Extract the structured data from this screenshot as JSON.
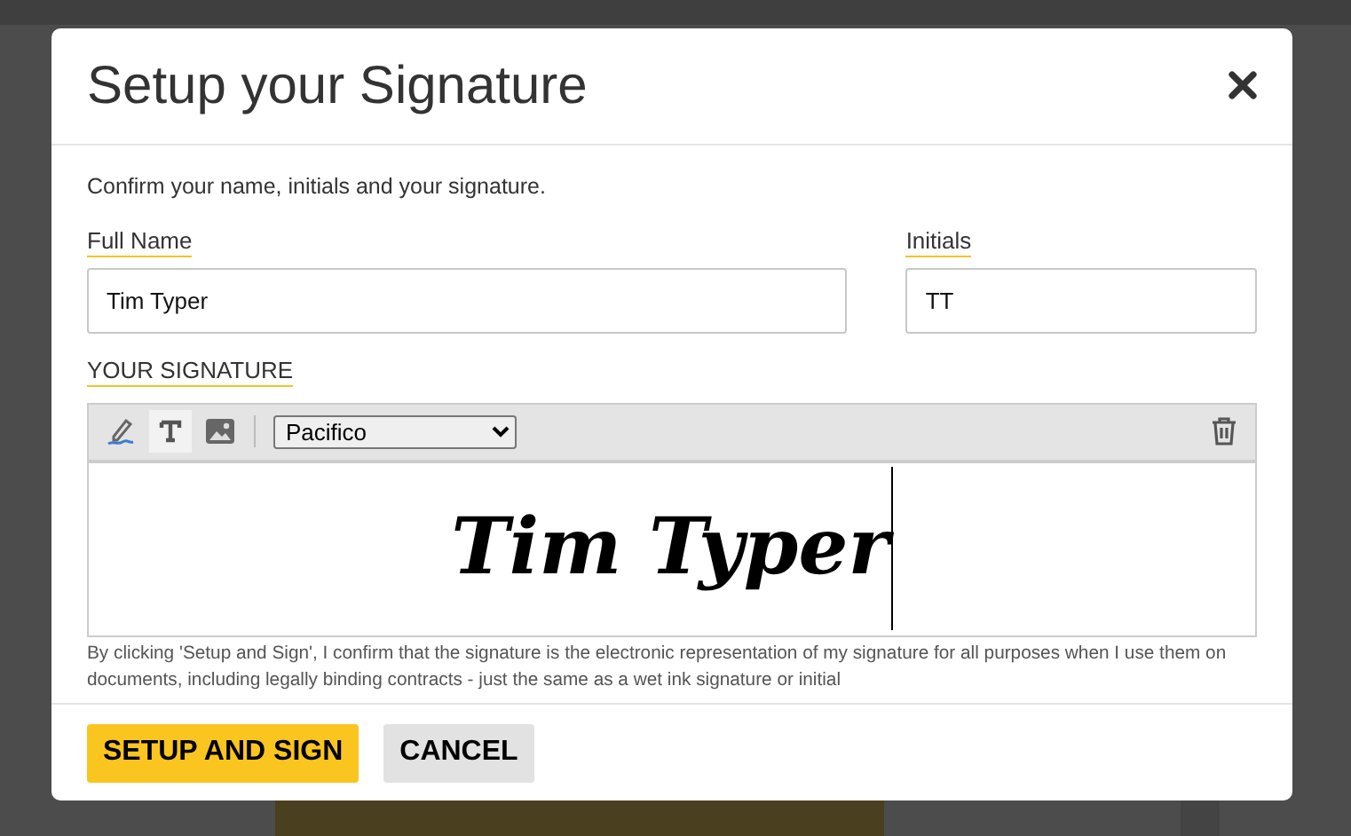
{
  "dialog": {
    "title": "Setup your Signature",
    "intro": "Confirm your name, initials and your signature.",
    "fields": [
      {
        "label": "Full Name",
        "value": "Tim Typer",
        "kind": "wide"
      },
      {
        "label": "Initials",
        "value": "TT",
        "kind": "narrow"
      }
    ],
    "signature": {
      "label": "YOUR SIGNATURE",
      "tools": [
        {
          "kind": "draw",
          "selected": false
        },
        {
          "kind": "type",
          "selected": true
        },
        {
          "kind": "image",
          "selected": false
        }
      ],
      "font": "Pacifico",
      "text": "Tim Typer"
    },
    "disclaimer": "By clicking 'Setup and Sign', I confirm that the signature is the electronic representation of my signature for all purposes when I use them on documents, including legally binding contracts - just the same as a wet ink signature or initial",
    "buttons": [
      {
        "label": "SETUP AND SIGN",
        "kind": "primary"
      },
      {
        "label": "CANCEL",
        "kind": "secondary"
      }
    ]
  }
}
